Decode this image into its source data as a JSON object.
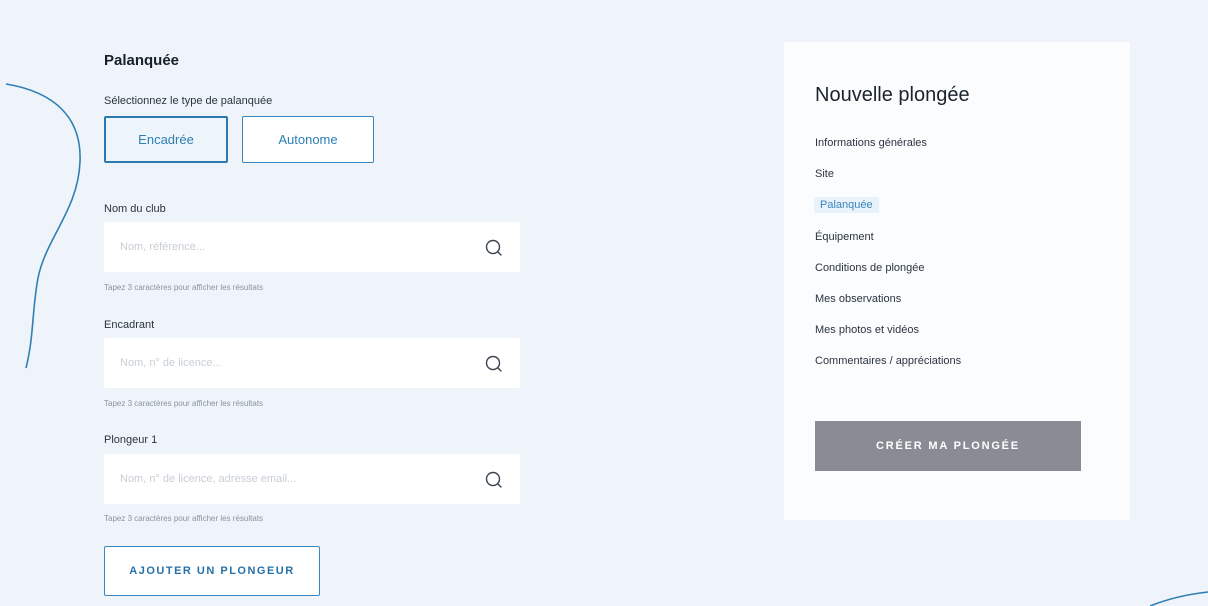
{
  "palanquee": {
    "title": "Palanquée",
    "type_label": "Sélectionnez le type de palanquée",
    "type_options": [
      "Encadrée",
      "Autonome"
    ],
    "selected_type": "Encadrée"
  },
  "fields": {
    "club": {
      "label": "Nom du club",
      "placeholder": "Nom, référence...",
      "hint": "Tapez 3 caractères pour afficher les résultats"
    },
    "encadrant": {
      "label": "Encadrant",
      "placeholder": "Nom, n° de licence...",
      "hint": "Tapez 3 caractères pour afficher les résultats"
    },
    "plongeur1": {
      "label": "Plongeur 1",
      "placeholder": "Nom, n° de licence, adresse email...",
      "hint": "Tapez 3 caractères pour afficher les résultats"
    }
  },
  "add_diver_label": "AJOUTER UN PLONGEUR",
  "sidebar": {
    "title": "Nouvelle plongée",
    "items": [
      "Informations générales",
      "Site",
      "Palanquée",
      "Équipement",
      "Conditions de plongée",
      "Mes observations",
      "Mes photos et vidéos",
      "Commentaires / appréciations"
    ],
    "active_item": "Palanquée",
    "create_label": "CRÉER MA PLONGÉE"
  },
  "colors": {
    "accent": "#2d7fb6",
    "background": "#eef4f9",
    "create_button": "#8a8c95"
  },
  "icons": {
    "search": "search-icon"
  }
}
